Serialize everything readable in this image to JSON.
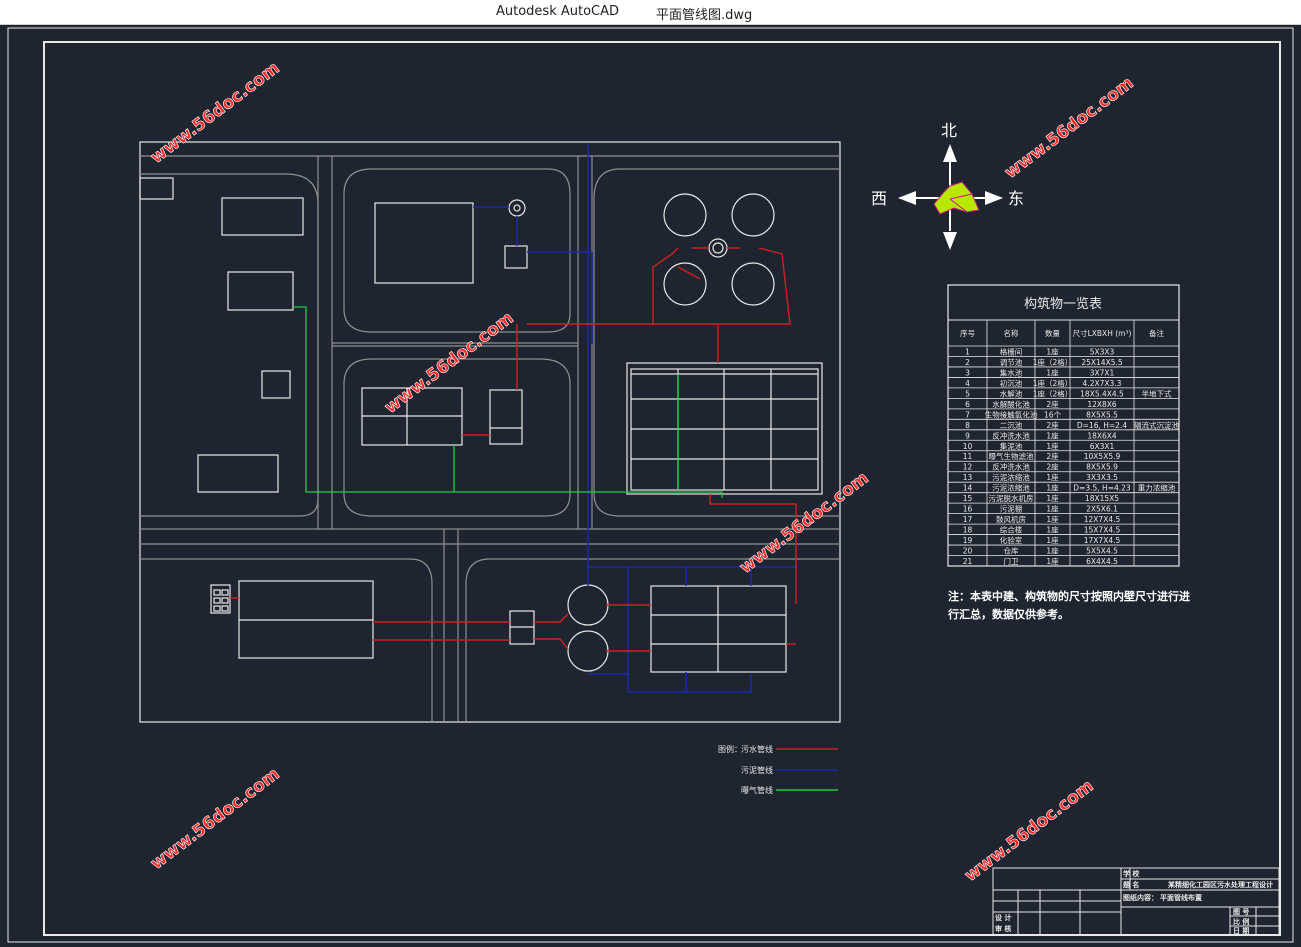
{
  "window": {
    "app_title": "Autodesk AutoCAD",
    "document_title": "平面管线图.dwg"
  },
  "compass": {
    "north": "北",
    "south_label": "",
    "west": "西",
    "east": "东"
  },
  "table": {
    "title": "构筑物一览表",
    "headers": [
      "序号",
      "名称",
      "数量",
      "尺寸LXBXH (m³)",
      "备注"
    ],
    "rows": [
      [
        "1",
        "格栅间",
        "1座",
        "5X3X3",
        ""
      ],
      [
        "2",
        "调节池",
        "1座（2格）",
        "25X14X5.5",
        ""
      ],
      [
        "3",
        "集水池",
        "1座",
        "3X7X1",
        ""
      ],
      [
        "4",
        "初沉池",
        "1座（2格）",
        "4.2X7X3.3",
        ""
      ],
      [
        "5",
        "水解池",
        "1座（2格）",
        "18X5.4X4.5",
        "半地下式"
      ],
      [
        "6",
        "水解酸化池",
        "2座",
        "12X8X6",
        ""
      ],
      [
        "7",
        "生物接触氧化池",
        "16个",
        "8X5X5.5",
        ""
      ],
      [
        "8",
        "二沉池",
        "2座",
        "D=16, H=2.4",
        "辐流式沉淀池"
      ],
      [
        "9",
        "反冲洗水池",
        "1座",
        "18X6X4",
        ""
      ],
      [
        "10",
        "集泥池",
        "1座",
        "6X3X1",
        ""
      ],
      [
        "11",
        "曝气生物滤池",
        "2座",
        "10X5X5.9",
        ""
      ],
      [
        "12",
        "反冲洗水池",
        "2座",
        "8X5X5.9",
        ""
      ],
      [
        "13",
        "污泥浓缩池",
        "1座",
        "3X3X3.5",
        ""
      ],
      [
        "14",
        "污泥浓缩池",
        "1座",
        "D=3.5, H=4.23",
        "重力浓缩池"
      ],
      [
        "15",
        "污泥脱水机房",
        "1座",
        "18X15X5",
        ""
      ],
      [
        "16",
        "污泥棚",
        "1座",
        "2X5X6.1",
        ""
      ],
      [
        "17",
        "鼓风机房",
        "1座",
        "12X7X4.5",
        ""
      ],
      [
        "18",
        "综合楼",
        "1座",
        "15X7X4.5",
        ""
      ],
      [
        "19",
        "化验室",
        "1座",
        "17X7X4.5",
        ""
      ],
      [
        "20",
        "仓库",
        "1座",
        "5X5X4.5",
        ""
      ],
      [
        "21",
        "门卫",
        "1座",
        "6X4X4.5",
        ""
      ]
    ]
  },
  "note": {
    "line1": "注：本表中建、构筑物的尺寸按照内壁尺寸进行进",
    "line2": "行汇总，数据仅供参考。"
  },
  "legend": {
    "title": "图例：",
    "items": [
      {
        "label": "污水管线",
        "color": "#cc2222"
      },
      {
        "label": "污泥管线",
        "color": "#1a2aa8"
      },
      {
        "label": "曝气管线",
        "color": "#22cc44"
      }
    ]
  },
  "title_block": {
    "school_label": "学  校",
    "name_label": "题  名",
    "project_name": "某精细化工园区污水处理工程设计",
    "drawing_content_label": "图纸内容：",
    "drawing_content": "平面管线布置",
    "left_labels": [
      "设 计",
      "审 核"
    ],
    "right_labels": [
      "图 号",
      "比 例",
      "日 期"
    ]
  },
  "watermarks": [
    "www.56doc.com",
    "www.56doc.com",
    "www.56doc.com",
    "www.56doc.com",
    "www.56doc.com",
    "www.56doc.com",
    "www.56doc.com"
  ],
  "colors": {
    "background": "#1f2530",
    "lines": "#e8e8e8",
    "road": "#8f8f8f",
    "sewage": "#cc2222",
    "sludge": "#1a2aa8",
    "aeration": "#22cc44",
    "watermark": "#ff2a2a"
  }
}
